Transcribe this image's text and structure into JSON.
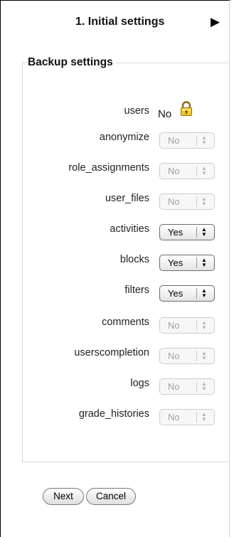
{
  "step": {
    "title": "1. Initial settings",
    "arrow_icon": "triangle-right-icon"
  },
  "section": {
    "legend": "Backup settings"
  },
  "settings": [
    {
      "label": "users",
      "value": "No",
      "kind": "static",
      "locked": true
    },
    {
      "label": "anonymize",
      "value": "No",
      "kind": "select",
      "enabled": false
    },
    {
      "label": "role_assignments",
      "value": "No",
      "kind": "select",
      "enabled": false
    },
    {
      "label": "user_files",
      "value": "No",
      "kind": "select",
      "enabled": false
    },
    {
      "label": "activities",
      "value": "Yes",
      "kind": "select",
      "enabled": true
    },
    {
      "label": "blocks",
      "value": "Yes",
      "kind": "select",
      "enabled": true
    },
    {
      "label": "filters",
      "value": "Yes",
      "kind": "select",
      "enabled": true
    },
    {
      "label": "comments",
      "value": "No",
      "kind": "select",
      "enabled": false
    },
    {
      "label": "userscompletion",
      "value": "No",
      "kind": "select",
      "enabled": false
    },
    {
      "label": "logs",
      "value": "No",
      "kind": "select",
      "enabled": false
    },
    {
      "label": "grade_histories",
      "value": "No",
      "kind": "select",
      "enabled": false
    }
  ],
  "buttons": {
    "next": "Next",
    "cancel": "Cancel"
  },
  "icons": {
    "lock": "padlock-icon",
    "select_arrows": "up-down-arrows-icon"
  }
}
